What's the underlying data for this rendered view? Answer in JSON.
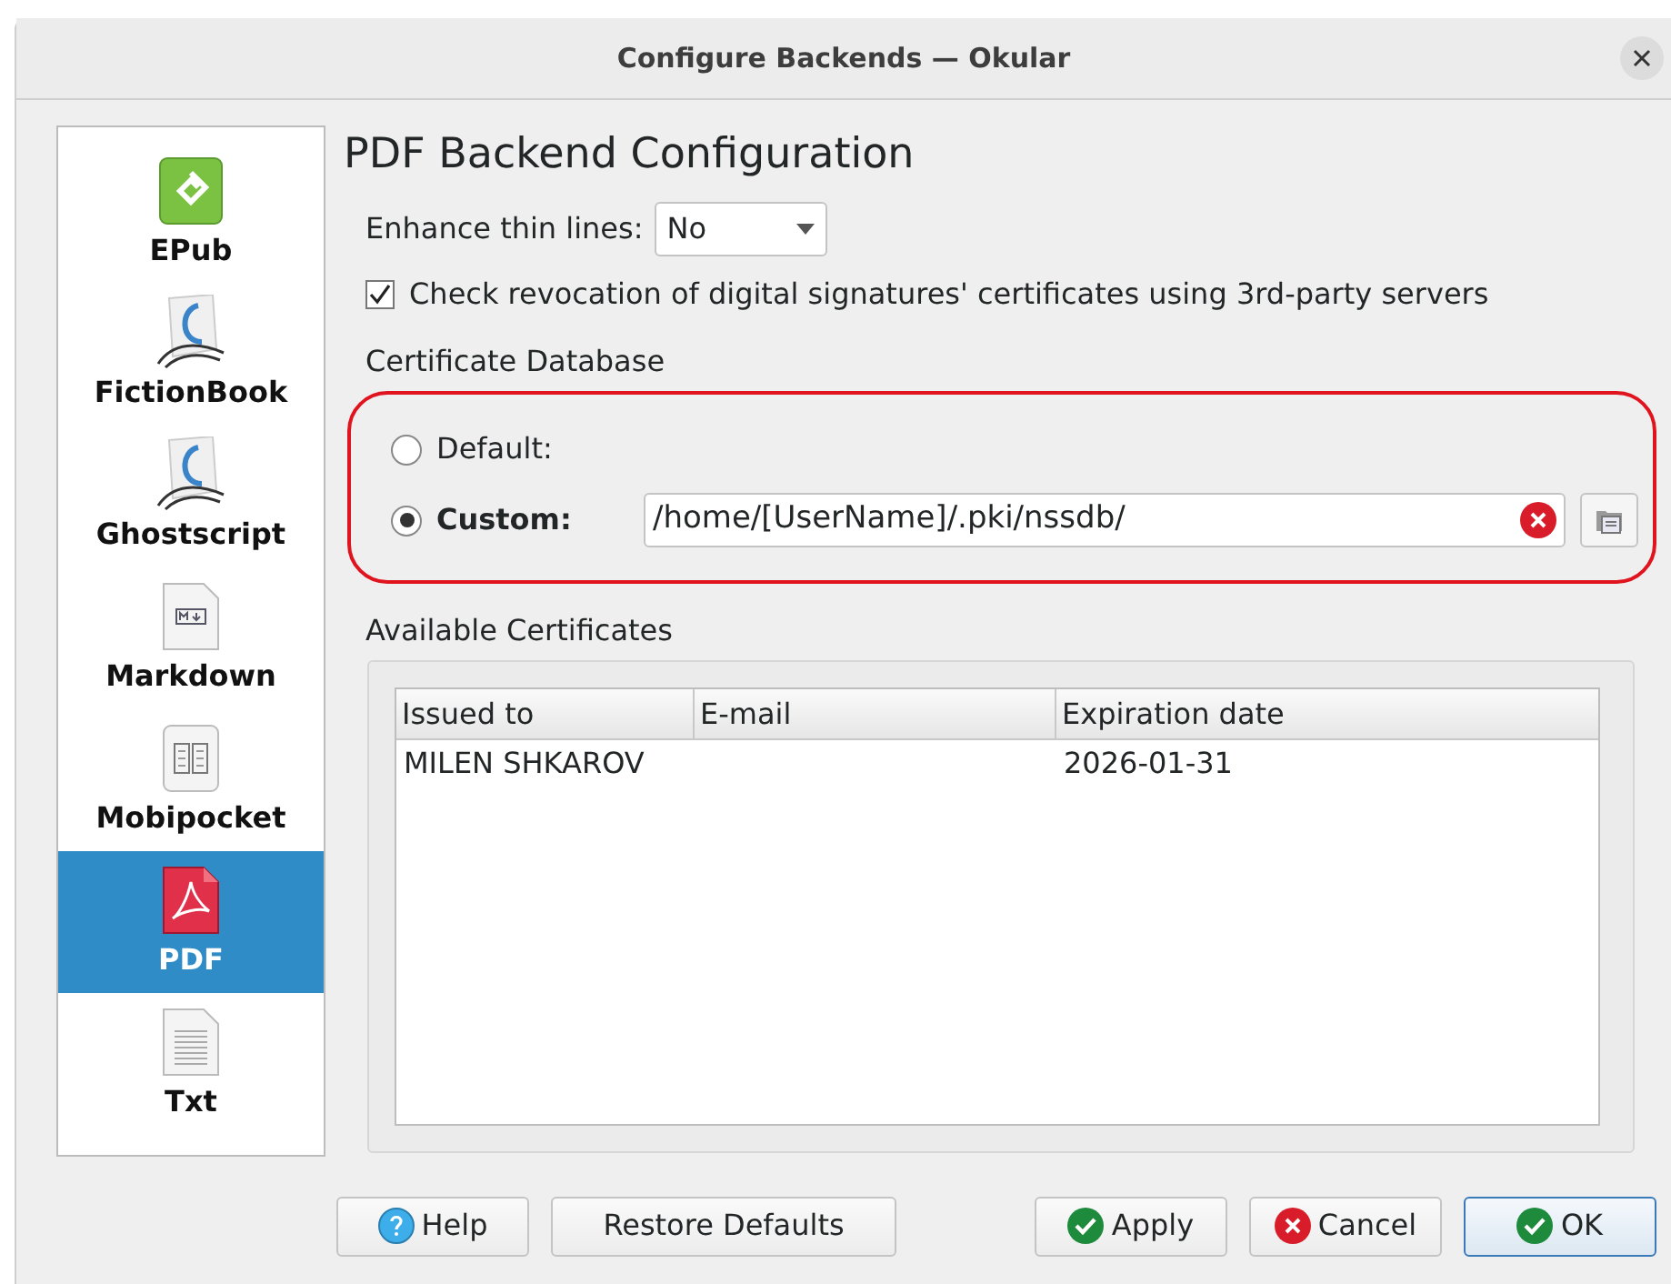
{
  "window": {
    "title": "Configure Backends — Okular"
  },
  "sidebar": {
    "items": [
      {
        "label": "EPub",
        "kind": "epub",
        "selected": false
      },
      {
        "label": "FictionBook",
        "kind": "book",
        "selected": false
      },
      {
        "label": "Ghostscript",
        "kind": "book",
        "selected": false
      },
      {
        "label": "Markdown",
        "kind": "markdown",
        "selected": false
      },
      {
        "label": "Mobipocket",
        "kind": "mobi",
        "selected": false
      },
      {
        "label": "PDF",
        "kind": "pdf",
        "selected": true
      },
      {
        "label": "Txt",
        "kind": "txt",
        "selected": false
      }
    ]
  },
  "page": {
    "title": "PDF Backend Configuration",
    "enhance": {
      "label": "Enhance thin lines:",
      "value": "No"
    },
    "revocation": {
      "label": "Check revocation of digital signatures' certificates using 3rd-party servers",
      "checked": true
    },
    "database": {
      "label": "Certificate Database",
      "options": [
        {
          "label": "Default:",
          "selected": false
        },
        {
          "label": "Custom:",
          "selected": true
        }
      ],
      "path": "/home/[UserName]/.pki/nssdb/"
    },
    "certificates": {
      "label": "Available Certificates",
      "columns": [
        "Issued to",
        "E-mail",
        "Expiration date"
      ],
      "rows": [
        [
          "MILEN SHKAROV",
          "",
          "2026-01-31"
        ]
      ]
    }
  },
  "buttons": [
    {
      "label": "Help",
      "kind": "help"
    },
    {
      "label": "Restore Defaults",
      "kind": "plain"
    },
    {
      "label": "Apply",
      "kind": "apply"
    },
    {
      "label": "Cancel",
      "kind": "cancel"
    },
    {
      "label": "OK",
      "kind": "ok"
    }
  ]
}
